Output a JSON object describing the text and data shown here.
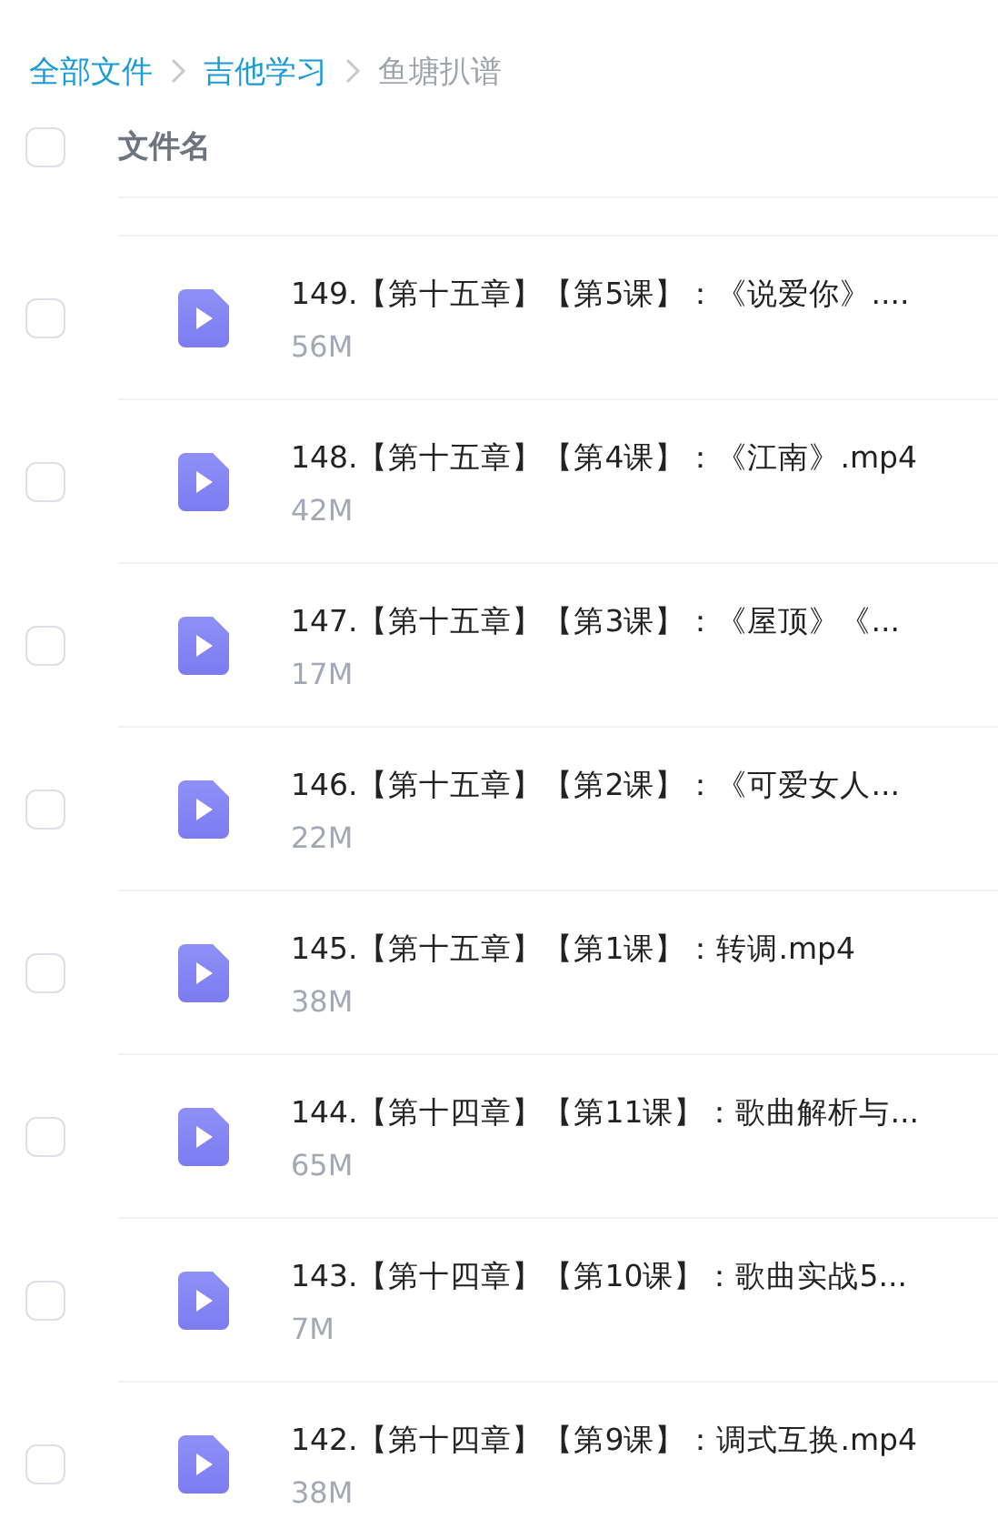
{
  "breadcrumb": [
    {
      "label": "全部文件",
      "current": false
    },
    {
      "label": "吉他学习",
      "current": false
    },
    {
      "label": "鱼塘扒谱",
      "current": true
    }
  ],
  "header": {
    "checked": false,
    "column": "文件名"
  },
  "files": [
    {
      "name": "149.【第十五章】【第5课】：《说爱你》....",
      "size": "56M",
      "checked": false
    },
    {
      "name": "148.【第十五章】【第4课】：《江南》.mp4",
      "size": "42M",
      "checked": false
    },
    {
      "name": "147.【第十五章】【第3课】：《屋顶》《...",
      "size": "17M",
      "checked": false
    },
    {
      "name": "146.【第十五章】【第2课】：《可爱女人...",
      "size": "22M",
      "checked": false
    },
    {
      "name": "145.【第十五章】【第1课】：转调.mp4",
      "size": "38M",
      "checked": false
    },
    {
      "name": "144.【第十四章】【第11课】：歌曲解析与...",
      "size": "65M",
      "checked": false
    },
    {
      "name": "143.【第十四章】【第10课】：歌曲实战5...",
      "size": "7M",
      "checked": false
    },
    {
      "name": "142.【第十四章】【第9课】：调式互换.mp4",
      "size": "38M",
      "checked": false
    }
  ]
}
